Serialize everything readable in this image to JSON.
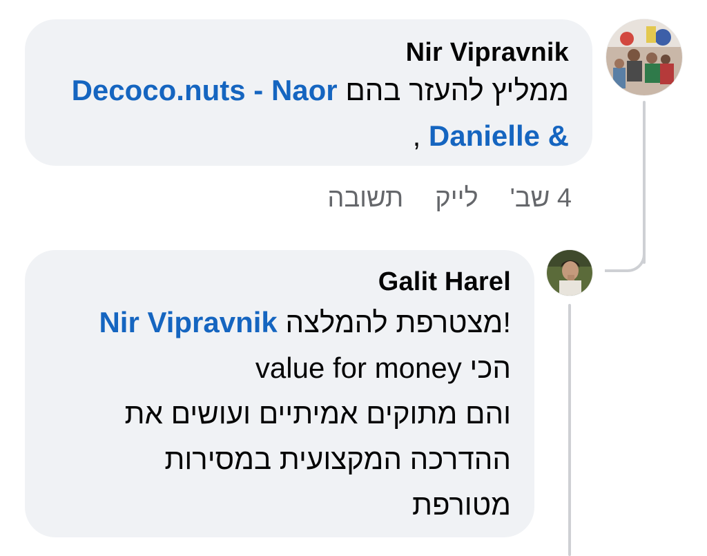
{
  "comments": [
    {
      "author": "Nir Vipravnik",
      "text_line1_plain": "ממליץ להעזר בהם ",
      "text_line1_mention": "Decoco.nuts - Naor",
      "text_line2_mention": "& Danielle",
      "text_line2_plain": " ,",
      "time": "4 שב'",
      "like_label": "לייק",
      "reply_label": "תשובה"
    },
    {
      "author": "Galit Harel",
      "line1_mention": "Nir Vipravnik",
      "line1_plain": "!מצטרפת להמלצה ",
      "line2": "הכי value for money",
      "line3": "והם מתוקים אמיתיים ועושים את",
      "line4": "ההדרכה המקצועית במסירות",
      "line5": "מטורפת"
    }
  ],
  "colors": {
    "bubble_bg": "#f0f2f5",
    "mention": "#1565c0",
    "meta_text": "#65676b",
    "thread_line": "#ced0d4"
  }
}
